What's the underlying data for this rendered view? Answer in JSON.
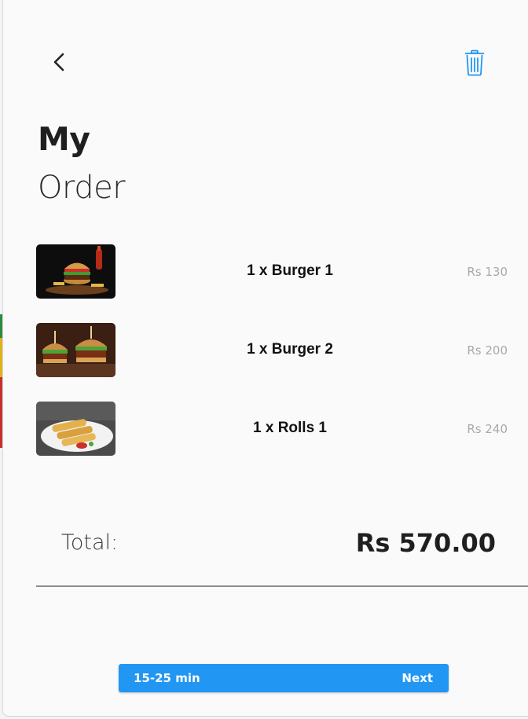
{
  "header": {
    "back_icon": "chevron-left-icon",
    "delete_icon": "trash-icon",
    "accent_color": "#2196f3"
  },
  "title": {
    "line1": "My",
    "line2": "Order"
  },
  "items": [
    {
      "name": "1 x Burger 1",
      "price": "Rs 130",
      "image": "burger-photo"
    },
    {
      "name": "1 x Burger 2",
      "price": "Rs 200",
      "image": "burger-photo"
    },
    {
      "name": "1 x Rolls 1",
      "price": "Rs 240",
      "image": "rolls-photo"
    }
  ],
  "summary": {
    "total_label": "Total:",
    "total_value": "Rs 570.00"
  },
  "footer": {
    "eta": "15-25 min",
    "next_label": "Next",
    "button_color": "#2196f3"
  }
}
